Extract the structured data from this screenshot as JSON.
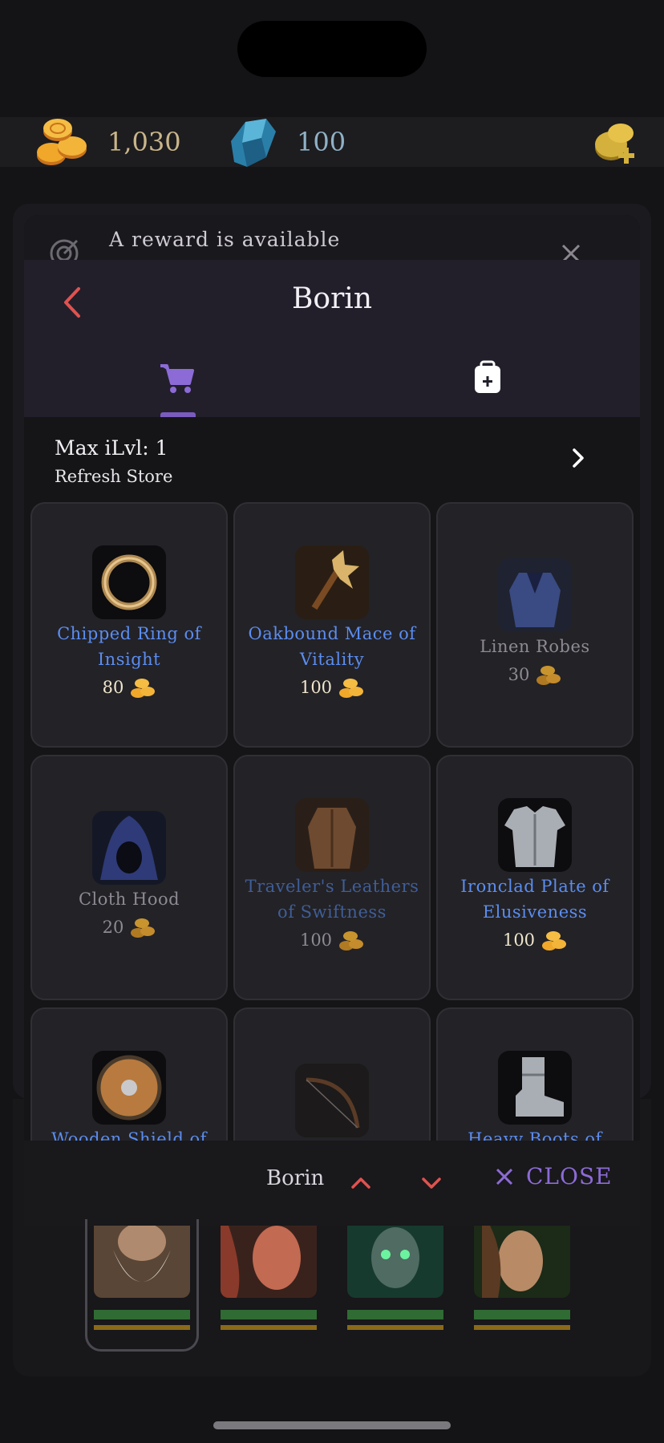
{
  "currency": {
    "gold": "1,030",
    "gems": "100"
  },
  "notification": {
    "text": "A reward is available"
  },
  "header": {
    "title": "Borin"
  },
  "store": {
    "max_ilvl": "Max iLvl: 1",
    "refresh": "Refresh Store"
  },
  "items": [
    {
      "name": "Chipped Ring of Insight",
      "price": "80",
      "rarity": "blue",
      "icon": "ring-icon"
    },
    {
      "name": "Oakbound Mace of Vitality",
      "price": "100",
      "rarity": "blue",
      "icon": "mace-icon"
    },
    {
      "name": "Linen Robes",
      "price": "30",
      "rarity": "grey",
      "icon": "robe-icon"
    },
    {
      "name": "Cloth Hood",
      "price": "20",
      "rarity": "grey",
      "icon": "hood-icon"
    },
    {
      "name": "Traveler's Leathers of Swiftness",
      "price": "100",
      "rarity": "dimblue",
      "icon": "leather-armor-icon"
    },
    {
      "name": "Ironclad Plate of Elusiveness",
      "price": "100",
      "rarity": "blue",
      "icon": "plate-armor-icon"
    },
    {
      "name": "Wooden Shield of",
      "price": "",
      "rarity": "blue",
      "icon": "shield-icon"
    },
    {
      "name": "",
      "price": "",
      "rarity": "grey",
      "icon": "bow-icon"
    },
    {
      "name": "Heavy Boots of",
      "price": "",
      "rarity": "blue",
      "icon": "boots-icon"
    }
  ],
  "bottom_bar": {
    "character": "Borin",
    "close_label": "CLOSE"
  },
  "colors": {
    "accent_purple": "#7b5bbf",
    "back_red": "#e0524f",
    "rare_blue": "#5b8df0"
  }
}
